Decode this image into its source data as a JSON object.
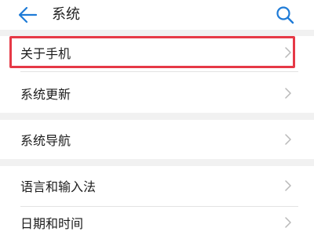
{
  "header": {
    "title": "系统",
    "back_icon": "arrow-left-icon",
    "search_icon": "search-icon"
  },
  "groups": [
    {
      "items": [
        {
          "label": "关于手机",
          "highlighted": true
        },
        {
          "label": "系统更新"
        }
      ]
    },
    {
      "items": [
        {
          "label": "系统导航"
        }
      ]
    },
    {
      "items": [
        {
          "label": "语言和输入法"
        },
        {
          "label": "日期和时间"
        }
      ]
    }
  ],
  "colors": {
    "accent": "#1e7bd7",
    "highlight": "#e63946",
    "background": "#f1f1f1",
    "card": "#ffffff"
  }
}
